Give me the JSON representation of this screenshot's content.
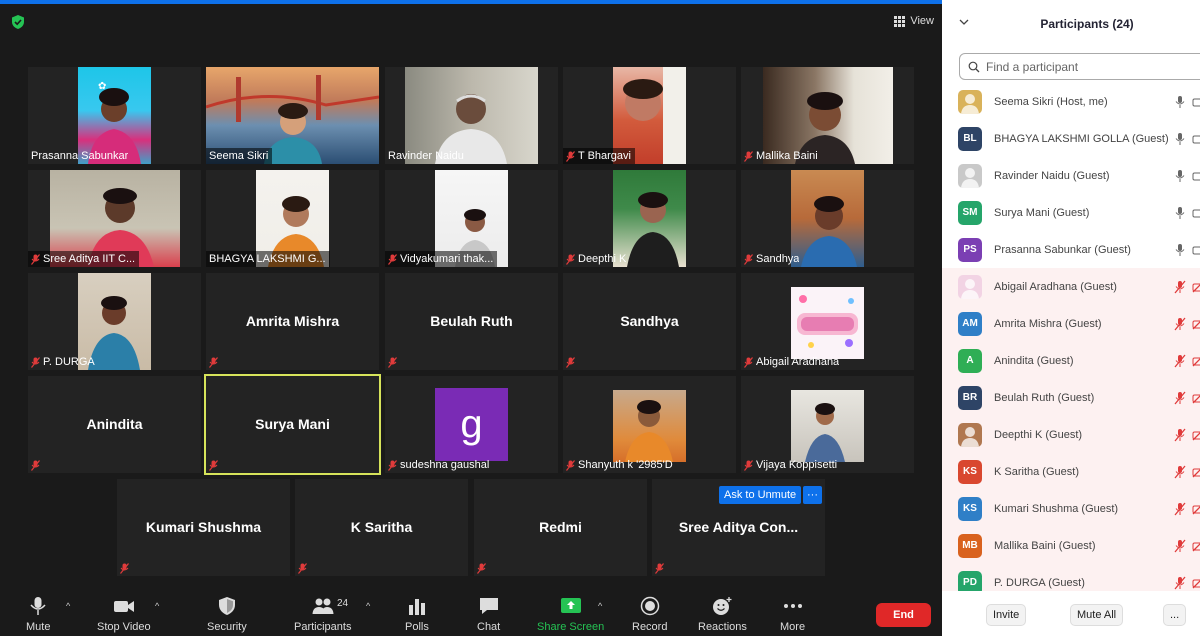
{
  "meeting": {
    "view_label": "View",
    "ask_unmute_label": "Ask to Unmute",
    "tile_more_label": "···",
    "tiles": [
      {
        "name": "Prasanna Sabunkar",
        "muted": false
      },
      {
        "name": "Seema Sikri",
        "muted": false
      },
      {
        "name": "Ravinder Naidu",
        "muted": false
      },
      {
        "name": "T Bhargavi",
        "muted": true
      },
      {
        "name": "Mallika Baini",
        "muted": true
      },
      {
        "name": "Sree Aditya IIT C...",
        "muted": true
      },
      {
        "name": "BHAGYA LAKSHMI G...",
        "muted": false
      },
      {
        "name": "Vidyakumari thak...",
        "muted": true
      },
      {
        "name": "Deepthi K",
        "muted": true
      },
      {
        "name": "Sandhya",
        "muted": true
      },
      {
        "name": "P. DURGA",
        "muted": true
      },
      {
        "name": "Amrita Mishra",
        "muted": true
      },
      {
        "name": "Beulah Ruth",
        "muted": true
      },
      {
        "name": "Sandhya",
        "muted": true
      },
      {
        "name": "Abigail Aradhana",
        "muted": true
      },
      {
        "name": "Anindita",
        "muted": true
      },
      {
        "name": "Surya Mani",
        "muted": true
      },
      {
        "name": "sudeshna gaushal",
        "muted": true
      },
      {
        "name": "Shanyuth k '2985'D",
        "muted": true
      },
      {
        "name": "Vijaya Koppisetti",
        "muted": true
      },
      {
        "name": "Kumari Shushma",
        "muted": true
      },
      {
        "name": "K Saritha",
        "muted": true
      },
      {
        "name": "Redmi",
        "muted": true
      },
      {
        "name": "Sree  Aditya  Con...",
        "muted": true
      }
    ],
    "g_avatar_letter": "g"
  },
  "toolbar": {
    "mute": "Mute",
    "stop_video": "Stop Video",
    "security": "Security",
    "participants": "Participants",
    "participants_count": "24",
    "polls": "Polls",
    "chat": "Chat",
    "share_screen": "Share Screen",
    "record": "Record",
    "reactions": "Reactions",
    "more": "More",
    "end": "End"
  },
  "panel": {
    "title": "Participants (24)",
    "search_placeholder": "Find a participant",
    "invite": "Invite",
    "mute_all": "Mute All",
    "more": "...",
    "participants": [
      {
        "name": "Seema Sikri (Host, me)",
        "initials": "",
        "color": "#d9b25a",
        "mic_on": true
      },
      {
        "name": "BHAGYA LAKSHMI GOLLA (Guest)",
        "initials": "BL",
        "color": "#2e4466",
        "mic_on": true
      },
      {
        "name": "Ravinder Naidu (Guest)",
        "initials": "",
        "color": "#c9c9c9",
        "mic_on": true
      },
      {
        "name": "Surya Mani (Guest)",
        "initials": "SM",
        "color": "#25a56a",
        "mic_on": true
      },
      {
        "name": "Prasanna Sabunkar (Guest)",
        "initials": "PS",
        "color": "#7b3fb3",
        "mic_on": true
      },
      {
        "name": "Abigail Aradhana (Guest)",
        "initials": "",
        "color": "#f2d3e4",
        "mic_on": false
      },
      {
        "name": "Amrita Mishra (Guest)",
        "initials": "AM",
        "color": "#2f7fc7",
        "mic_on": false
      },
      {
        "name": "Anindita (Guest)",
        "initials": "A",
        "color": "#2fae55",
        "mic_on": false
      },
      {
        "name": "Beulah Ruth (Guest)",
        "initials": "BR",
        "color": "#2e4466",
        "mic_on": false
      },
      {
        "name": "Deepthi K (Guest)",
        "initials": "",
        "color": "#b07850",
        "mic_on": false
      },
      {
        "name": "K Saritha (Guest)",
        "initials": "KS",
        "color": "#d9472f",
        "mic_on": false
      },
      {
        "name": "Kumari Shushma (Guest)",
        "initials": "KS",
        "color": "#2f7fc7",
        "mic_on": false
      },
      {
        "name": "Mallika Baini (Guest)",
        "initials": "MB",
        "color": "#d9621e",
        "mic_on": false
      },
      {
        "name": "P. DURGA (Guest)",
        "initials": "PD",
        "color": "#25a56a",
        "mic_on": false
      }
    ]
  }
}
